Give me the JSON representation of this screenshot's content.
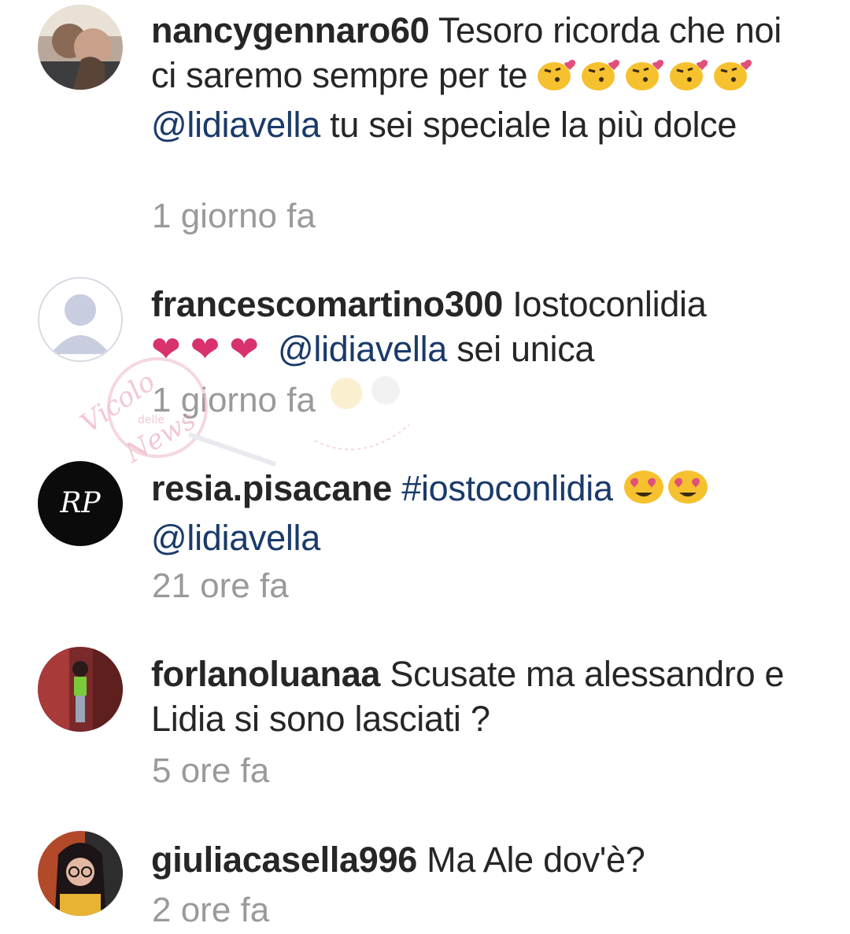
{
  "comments": [
    {
      "username": "nancygennaro60",
      "text_1": " Tesoro ricorda che noi ci saremo sempre per te ",
      "mention": "@lidiavella",
      "text_2": "  tu sei speciale la più dolce",
      "time": "1 giorno fa",
      "emoji": "kissing-heart-face"
    },
    {
      "username": "francescomartino300",
      "text_1": " Iostoconlidia ",
      "hearts": "❤ ❤ ❤",
      "mention": "@lidiavella",
      "text_2": " sei unica",
      "time": "1 giorno fa"
    },
    {
      "username": "resia.pisacane",
      "hashtag": "#iostoconlidia",
      "mention": "@lidiavella",
      "avatar_initials": "RP",
      "time": "21 ore fa",
      "emoji": "heart-eyes-face"
    },
    {
      "username": "forlanoluanaa",
      "text_1": " Scusate ma alessandro e Lidia si sono lasciati ?",
      "time": "5 ore fa"
    },
    {
      "username": "giuliacasella996",
      "text_1": " Ma Ale dov'è?",
      "time": "2 ore fa"
    }
  ],
  "watermark": {
    "line1": "Vicolo",
    "line2": "delle",
    "line3": "News"
  },
  "colors": {
    "link": "#1a3a6a",
    "time": "#9a9a9a",
    "heart": "#d8326e",
    "emoji": "#f6c12e"
  }
}
